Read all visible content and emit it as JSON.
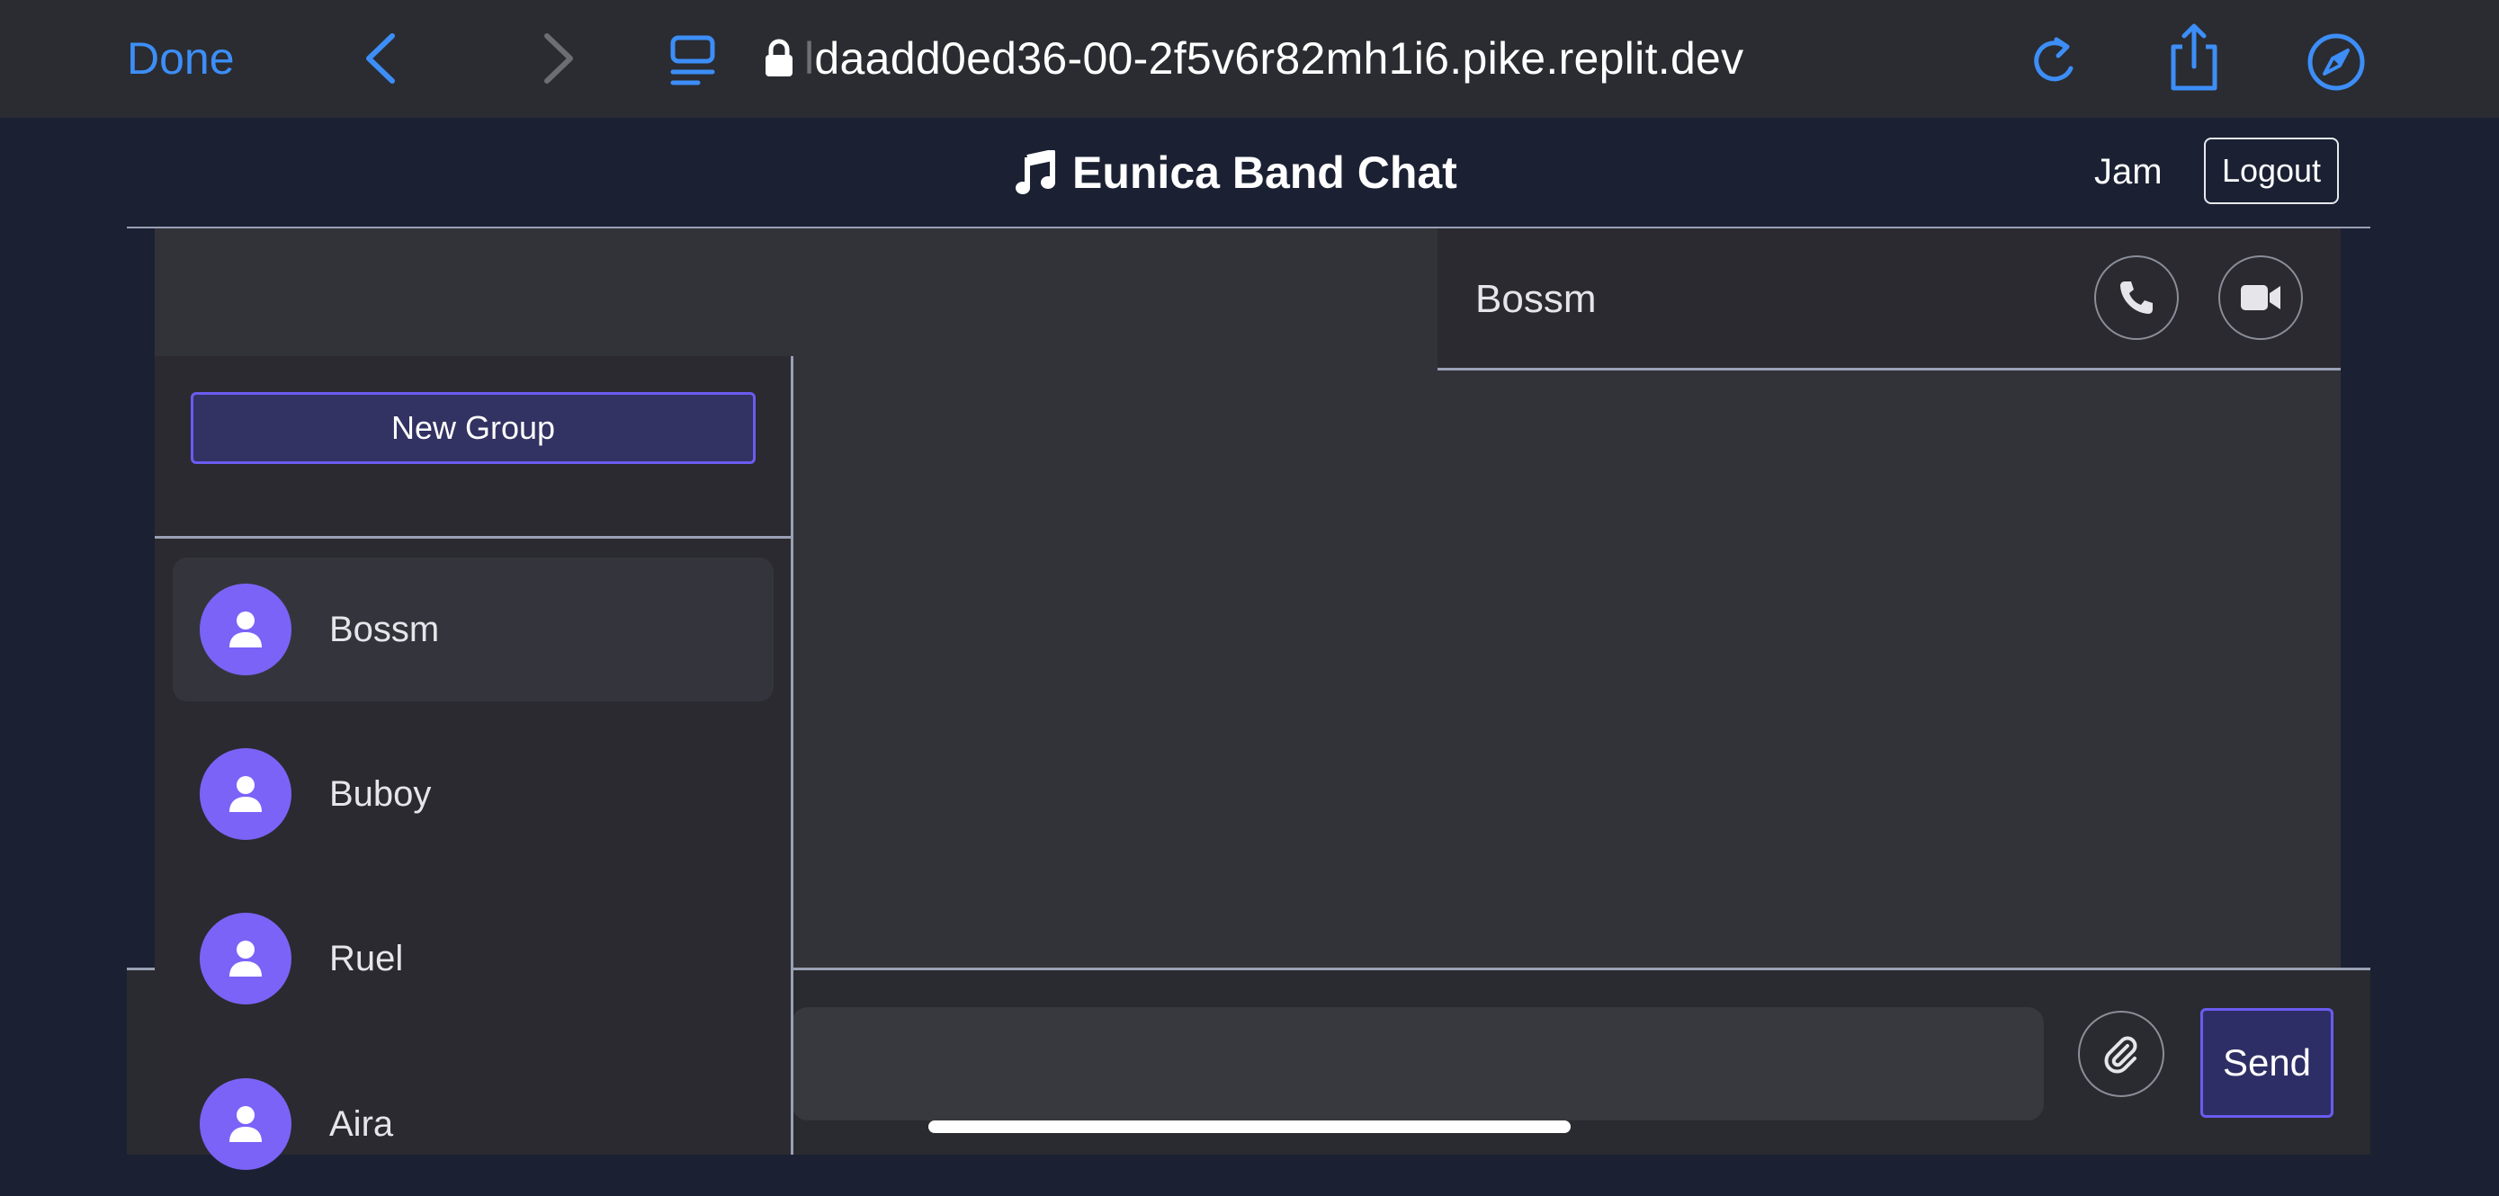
{
  "browser": {
    "done_label": "Done",
    "url": "daadd0ed36-00-2f5v6r82mh1i6.pike.replit.dev",
    "url_prefix_faded": "l"
  },
  "app": {
    "title": "Eunica Band Chat",
    "current_user": "Jam",
    "logout_label": "Logout"
  },
  "sidebar": {
    "new_group_label": "New Group",
    "contacts": [
      {
        "name": "Bossm",
        "active": true
      },
      {
        "name": "Buboy",
        "active": false
      },
      {
        "name": "Ruel",
        "active": false
      },
      {
        "name": "Aira",
        "active": false
      }
    ]
  },
  "chat": {
    "partner_name": "Bossm",
    "send_label": "Send",
    "message_placeholder": ""
  },
  "colors": {
    "accent": "#7b63f7",
    "link_blue": "#3d8ef7",
    "background": "#1b2133"
  }
}
